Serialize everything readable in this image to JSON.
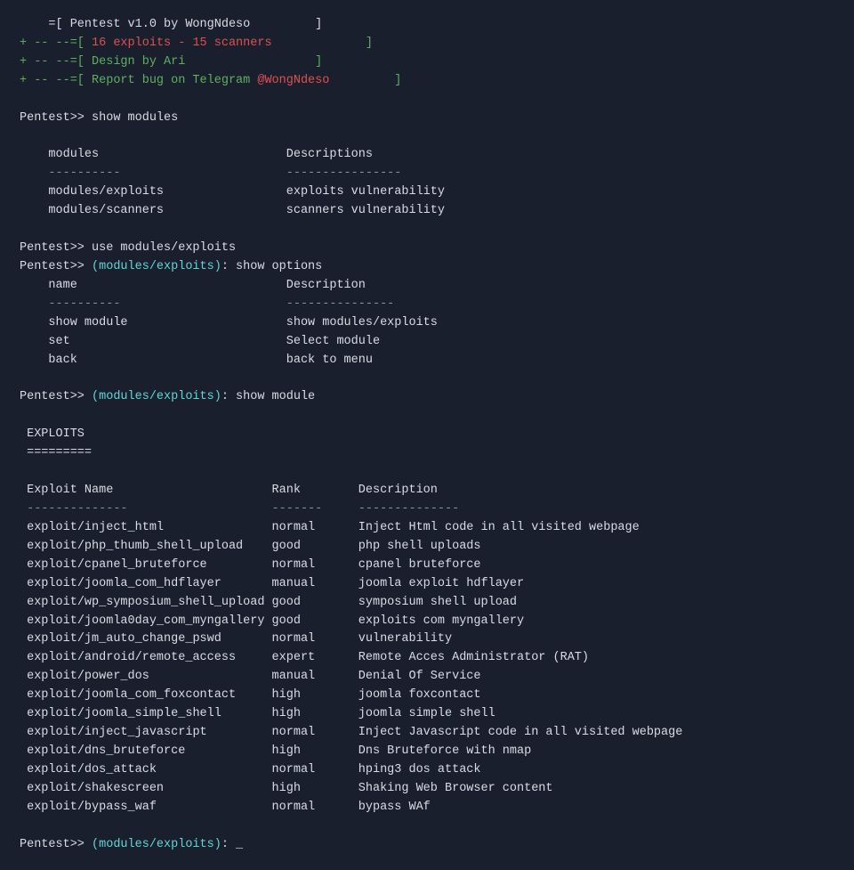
{
  "terminal": {
    "header": {
      "line1": "=[ Pentest v1.0 by WongNdeso         ]",
      "line2_prefix": "+ -- --=[ ",
      "line2_highlight": "16 exploits - 15 scanners",
      "line2_suffix": "             ]",
      "line3": "+ -- --=[ Design by Ari                  ]",
      "line4_prefix": "+ -- --=[ Report bug on Telegram ",
      "line4_highlight": "@WongNdeso",
      "line4_suffix": "         ]"
    },
    "show_modules_cmd": "Pentest>> show modules",
    "modules_table": {
      "col1_header": "modules",
      "col2_header": "Descriptions",
      "dashes1": "----------",
      "dashes2": "----------------",
      "rows": [
        {
          "name": "modules/exploits",
          "desc": "exploits vulnerability"
        },
        {
          "name": "modules/scanners",
          "desc": "scanners vulnerability"
        }
      ]
    },
    "use_cmd": "Pentest>> use modules/exploits",
    "show_options_cmd_prefix": "Pentest>> ",
    "show_options_module": "(modules/exploits)",
    "show_options_suffix": ": show options",
    "options_table": {
      "col1_header": "name",
      "col2_header": "Description",
      "dashes1": "----------",
      "dashes2": "---------------",
      "rows": [
        {
          "name": "show module",
          "desc": "show modules/exploits"
        },
        {
          "name": "set",
          "desc": "Select module"
        },
        {
          "name": "back",
          "desc": "back to menu"
        }
      ]
    },
    "show_module_cmd_prefix": "Pentest>> ",
    "show_module_module": "(modules/exploits)",
    "show_module_suffix": ": show module",
    "exploits_section": {
      "title": "EXPLOITS",
      "equals": "=========",
      "col1_header": "Exploit Name",
      "col2_header": "Rank",
      "col3_header": "Description",
      "dashes1": "--------------",
      "dashes2": "-------",
      "dashes3": "--------------",
      "rows": [
        {
          "name": "exploit/inject_html",
          "rank": "normal",
          "desc": "Inject Html code in all visited webpage"
        },
        {
          "name": "exploit/php_thumb_shell_upload",
          "rank": "good",
          "desc": "php shell uploads"
        },
        {
          "name": "exploit/cpanel_bruteforce",
          "rank": "normal",
          "desc": "cpanel bruteforce"
        },
        {
          "name": "exploit/joomla_com_hdflayer",
          "rank": "manual",
          "desc": "joomla exploit hdflayer"
        },
        {
          "name": "exploit/wp_symposium_shell_upload",
          "rank": "good",
          "desc": "symposium shell upload"
        },
        {
          "name": "exploit/joomla0day_com_myngallery",
          "rank": "good",
          "desc": "exploits com myngallery"
        },
        {
          "name": "exploit/jm_auto_change_pswd",
          "rank": "normal",
          "desc": "vulnerability"
        },
        {
          "name": "exploit/android/remote_access",
          "rank": "expert",
          "desc": "Remote Acces Administrator (RAT)"
        },
        {
          "name": "exploit/power_dos",
          "rank": "manual",
          "desc": "Denial Of Service"
        },
        {
          "name": "exploit/joomla_com_foxcontact",
          "rank": "high",
          "desc": "joomla foxcontact"
        },
        {
          "name": "exploit/joomla_simple_shell",
          "rank": "high",
          "desc": "joomla simple shell"
        },
        {
          "name": "exploit/inject_javascript",
          "rank": "normal",
          "desc": "Inject Javascript code in all visited webpage"
        },
        {
          "name": "exploit/dns_bruteforce",
          "rank": "high",
          "desc": "Dns Bruteforce with nmap"
        },
        {
          "name": "exploit/dos_attack",
          "rank": "normal",
          "desc": "hping3 dos attack"
        },
        {
          "name": "exploit/shakescreen",
          "rank": "high",
          "desc": "Shaking Web Browser content"
        },
        {
          "name": "exploit/bypass_waf",
          "rank": "normal",
          "desc": "bypass WAf"
        }
      ]
    },
    "bottom_prompt_prefix": "Pentest>> ",
    "bottom_prompt_module": "(modules/exploits)",
    "bottom_prompt_suffix": ": "
  }
}
